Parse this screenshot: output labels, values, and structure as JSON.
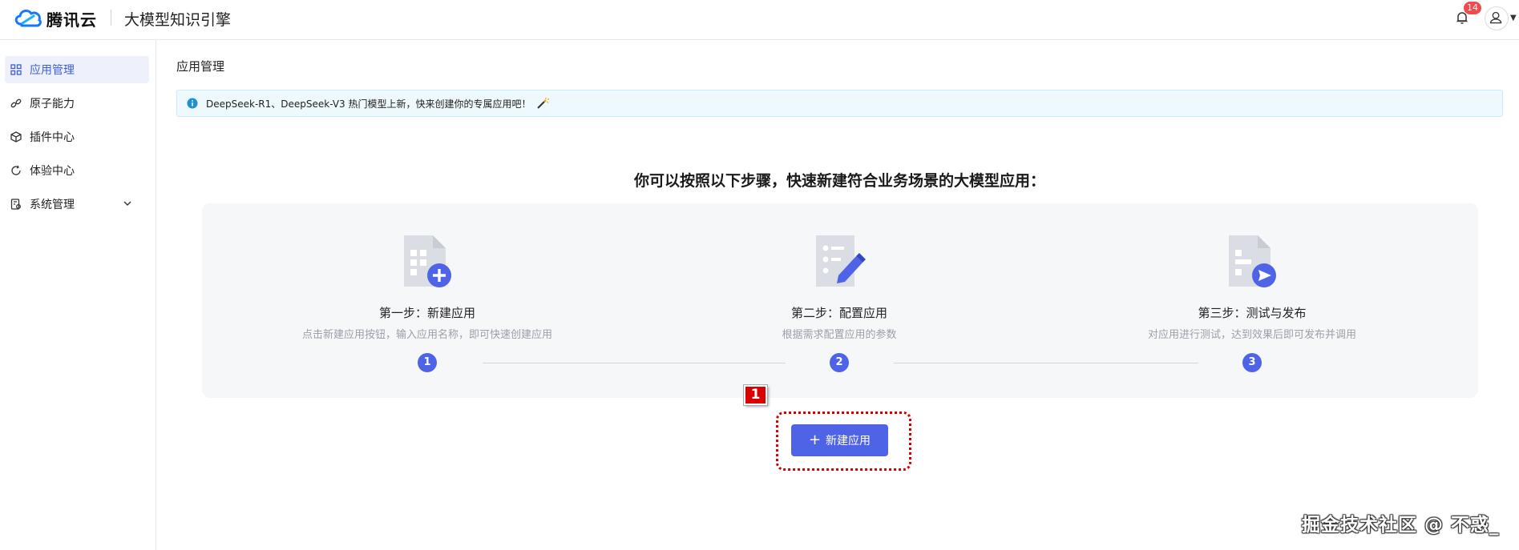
{
  "header": {
    "brand": "腾讯云",
    "product": "大模型知识引擎",
    "notification_count": "14"
  },
  "sidebar": {
    "items": [
      {
        "label": "应用管理",
        "icon": "grid-icon",
        "active": true
      },
      {
        "label": "原子能力",
        "icon": "link-icon"
      },
      {
        "label": "插件中心",
        "icon": "cube-icon"
      },
      {
        "label": "体验中心",
        "icon": "refresh-icon"
      },
      {
        "label": "系统管理",
        "icon": "settings-doc-icon",
        "expandable": true
      }
    ]
  },
  "main": {
    "page_title": "应用管理",
    "notice": "DeepSeek-R1、DeepSeek-V3 热门模型上新，快来创建你的专属应用吧！",
    "guide_title": "你可以按照以下步骤，快速新建符合业务场景的大模型应用：",
    "steps": [
      {
        "title": "第一步：新建应用",
        "desc": "点击新建应用按钮，输入应用名称，即可快速创建应用",
        "num": "1",
        "icon": "doc-plus-icon"
      },
      {
        "title": "第二步：配置应用",
        "desc": "根据需求配置应用的参数",
        "num": "2",
        "icon": "doc-edit-icon"
      },
      {
        "title": "第三步：测试与发布",
        "desc": "对应用进行测试，达到效果后即可发布并调用",
        "num": "3",
        "icon": "doc-send-icon"
      }
    ],
    "create_button": "新建应用",
    "annotation_marker": "1"
  },
  "watermark": "掘金技术社区 @ 不惑_",
  "colors": {
    "accent": "#4f63e6",
    "active_bg": "#eef1fc",
    "notice_bg": "#eef9fd",
    "annotation_red": "#d90000"
  }
}
